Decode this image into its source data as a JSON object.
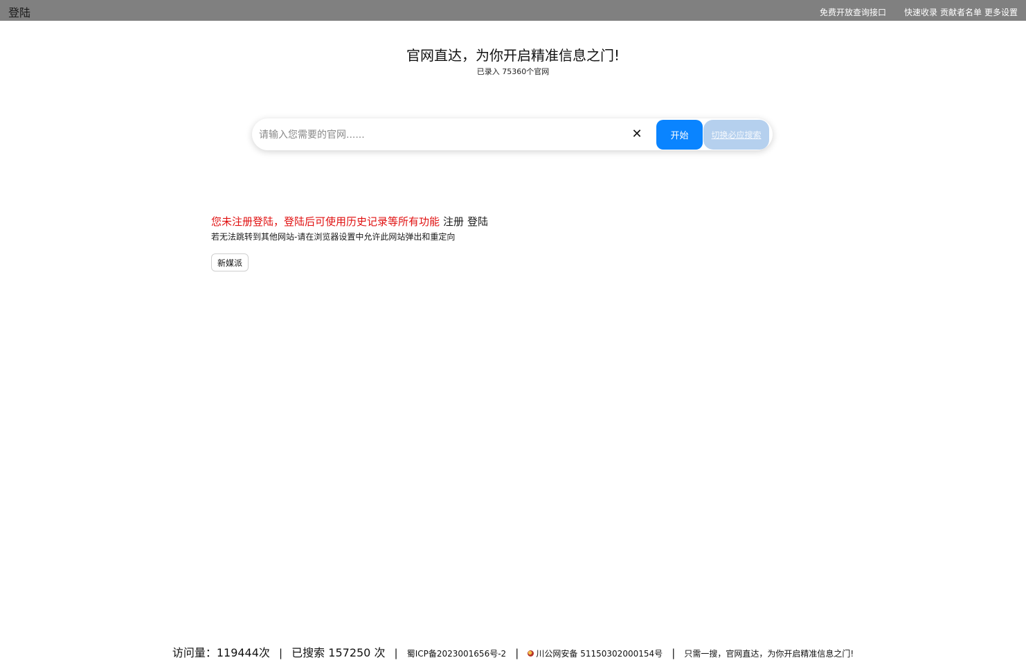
{
  "topbar": {
    "login_label": "登陆",
    "links": [
      "免费开放查询接口",
      "快速收录",
      "贡献者名单",
      "更多设置"
    ]
  },
  "hero": {
    "title": "官网直达，为你开启精准信息之门!",
    "subtitle": "已录入 75360个官网"
  },
  "search": {
    "placeholder": "请输入您需要的官网......",
    "value": "",
    "clear_icon": "close-icon",
    "start_label": "开始",
    "switch_label": "切换必应搜索"
  },
  "notice": {
    "warning": "您未注册登陆，登陆后可使用历史记录等所有功能",
    "register_label": "注册",
    "login_label": "登陆",
    "hint": "若无法跳转到其他网站-请在浏览器设置中允许此网站弹出和重定向"
  },
  "tags": [
    "新媒派"
  ],
  "footer": {
    "visits_label": "访问量：",
    "visits_value": "119444次",
    "searched_label": "已搜索",
    "searched_value": "157250 次",
    "icp": "蜀ICP备2023001656号-2",
    "police_icon": "police-badge-icon",
    "police": "川公网安备 51150302000154号",
    "slogan": "只需一搜，官网直达，为你开启精准信息之门!"
  },
  "colors": {
    "topbar_bg": "#808080",
    "primary_button": "#0a84ff",
    "secondary_button": "#b5d0ee",
    "warning_text": "#e01010"
  }
}
